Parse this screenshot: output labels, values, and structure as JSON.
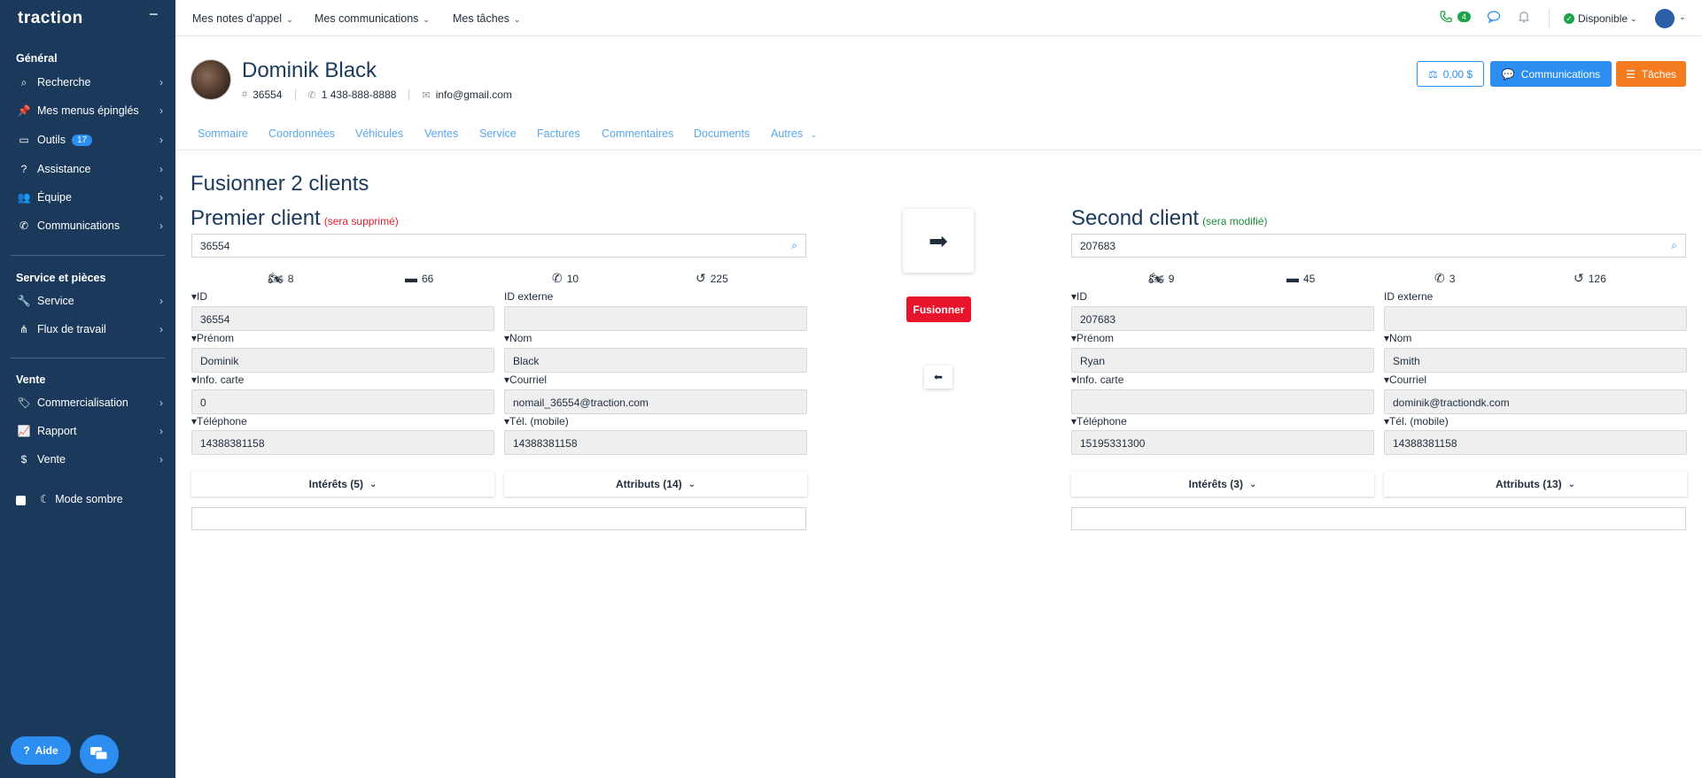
{
  "app": {
    "logo": "traction"
  },
  "sidebar": {
    "sections": [
      {
        "title": "Général",
        "items": [
          {
            "label": "Recherche",
            "icon": "search-icon"
          },
          {
            "label": "Mes menus épinglés",
            "icon": "pin-icon"
          },
          {
            "label": "Outils",
            "icon": "monitor-icon",
            "badge": "17"
          },
          {
            "label": "Assistance",
            "icon": "help-circle-icon"
          },
          {
            "label": "Équipe",
            "icon": "team-icon"
          },
          {
            "label": "Communications",
            "icon": "phone-icon"
          }
        ]
      },
      {
        "title": "Service et pièces",
        "items": [
          {
            "label": "Service",
            "icon": "wrench-icon"
          },
          {
            "label": "Flux de travail",
            "icon": "workflow-icon"
          }
        ]
      },
      {
        "title": "Vente",
        "items": [
          {
            "label": "Commercialisation",
            "icon": "tag-icon"
          },
          {
            "label": "Rapport",
            "icon": "chart-icon"
          },
          {
            "label": "Vente",
            "icon": "dollar-icon"
          }
        ]
      }
    ],
    "dark_mode_label": "Mode sombre",
    "help_label": "Aide"
  },
  "topbar": {
    "menus": [
      "Mes notes d'appel",
      "Mes communications",
      "Mes tâches"
    ],
    "phone_badge": "4",
    "status": "Disponible"
  },
  "customer": {
    "name": "Dominik Black",
    "id": "36554",
    "phone": "1 438-888-8888",
    "email": "info@gmail.com",
    "balance": "0,00 $",
    "communications_label": "Communications",
    "tasks_label": "Tâches"
  },
  "tabs": [
    "Sommaire",
    "Coordonnées",
    "Véhicules",
    "Ventes",
    "Service",
    "Factures",
    "Commentaires",
    "Documents",
    "Autres"
  ],
  "merge": {
    "title": "Fusionner 2 clients",
    "merge_button": "Fusionner",
    "labels": {
      "id": "▾ID",
      "external_id": "ID externe",
      "first_name": "▾Prénom",
      "last_name": "▾Nom",
      "card_info": "▾Info. carte",
      "email": "▾Courriel",
      "phone": "▾Téléphone",
      "mobile": "▾Tél. (mobile)"
    },
    "first": {
      "title": "Premier client",
      "note": "(sera supprimé)",
      "search": "36554",
      "stats": {
        "vehicles": "8",
        "messages": "66",
        "calls": "10",
        "history": "225"
      },
      "id": "36554",
      "external_id": "",
      "first_name": "Dominik",
      "last_name": "Black",
      "card_info": "0",
      "email": "nomail_36554@traction.com",
      "phone": "14388381158",
      "mobile": "14388381158",
      "interests": "Intérêts (5)",
      "attributes": "Attributs (14)"
    },
    "second": {
      "title": "Second client",
      "note": "(sera modifié)",
      "search": "207683",
      "stats": {
        "vehicles": "9",
        "messages": "45",
        "calls": "3",
        "history": "126"
      },
      "id": "207683",
      "external_id": "",
      "first_name": "Ryan",
      "last_name": "Smith",
      "card_info": "",
      "email": "dominik@tractiondk.com",
      "phone": "15195331300",
      "mobile": "14388381158",
      "interests": "Intérêts (3)",
      "attributes": "Attributs (13)"
    }
  }
}
